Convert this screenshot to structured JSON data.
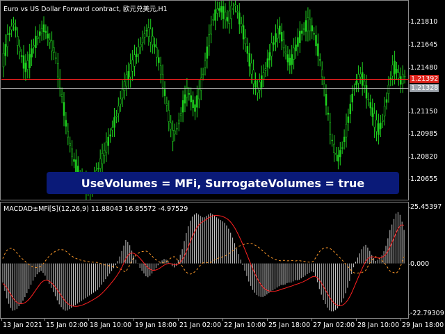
{
  "price_chart": {
    "title": "Euro vs US Dollar Forward contract, 欧元兑美元,H1",
    "scale_labels": [
      "1.21810",
      "1.21645",
      "1.21480",
      "1.21150",
      "1.20985",
      "1.20820",
      "1.20655"
    ],
    "bid_price": "1.21392",
    "ask_price": "1.21328",
    "candle_color": "#1fd21f",
    "closes": [
      1.215,
      1.2162,
      1.217,
      1.2175,
      1.216,
      1.2152,
      1.2145,
      1.2148,
      1.2158,
      1.2163,
      1.2168,
      1.2171,
      1.2166,
      1.216,
      1.2155,
      1.214,
      1.2125,
      1.2108,
      1.2095,
      1.2085,
      1.2078,
      1.2072,
      1.2068,
      1.2065,
      1.2066,
      1.2074,
      1.208,
      1.2086,
      1.2093,
      1.21,
      1.2108,
      1.2115,
      1.2125,
      1.2134,
      1.214,
      1.2146,
      1.2152,
      1.2158,
      1.2164,
      1.217,
      1.2166,
      1.216,
      1.2152,
      1.214,
      1.2126,
      1.2112,
      1.21,
      1.2104,
      1.2112,
      1.2122,
      1.213,
      1.2124,
      1.2118,
      1.2126,
      1.2138,
      1.215,
      1.2165,
      1.2177,
      1.2182,
      1.2184,
      1.218,
      1.2176,
      1.2182,
      1.2186,
      1.2178,
      1.217,
      1.216,
      1.2148,
      1.2138,
      1.213,
      1.2135,
      1.2142,
      1.215,
      1.2158,
      1.2165,
      1.217,
      1.2162,
      1.2152,
      1.2148,
      1.2155,
      1.2162,
      1.2168,
      1.2172,
      1.2174,
      1.217,
      1.2162,
      1.215,
      1.2134,
      1.2118,
      1.21,
      1.209,
      1.2085,
      1.2092,
      1.2102,
      1.2115,
      1.2128,
      1.2136,
      1.214,
      1.2135,
      1.2125,
      1.2118,
      1.2108,
      1.2104,
      1.211,
      1.2122,
      1.2136,
      1.2146,
      1.2142,
      1.2136,
      1.2139
    ]
  },
  "banner": {
    "text": "UseVolumes = MFi, SurrogateVolumes = true"
  },
  "indicator": {
    "title": "MACDAD±MFi[S](12,26,9) 11.88043 16.85572 -4.97529",
    "scale_labels": [
      "25.45397",
      "0.000",
      "-22.79309"
    ],
    "histogram_color": "#c8c8c8",
    "signal_color": "#ff2020",
    "dashed_color": "#ff9a2a",
    "histogram": [
      -8,
      -14,
      -18,
      -20,
      -19,
      -17,
      -15,
      -12,
      -9,
      -6,
      -4,
      -3,
      -5,
      -8,
      -11,
      -14,
      -17,
      -19,
      -20,
      -19,
      -18,
      -17,
      -16,
      -15,
      -14,
      -13,
      -12,
      -11,
      -9,
      -7,
      -5,
      -3,
      -1,
      2,
      6,
      10,
      8,
      4,
      1,
      -2,
      -4,
      -6,
      -5,
      -3,
      -1,
      1,
      2,
      1,
      -1,
      -2,
      2,
      6,
      12,
      17,
      20,
      21,
      20,
      19,
      20,
      21,
      20,
      19,
      18,
      17,
      15,
      12,
      8,
      4,
      0,
      -4,
      -8,
      -11,
      -13,
      -14,
      -14,
      -13,
      -12,
      -11,
      -10,
      -9,
      -9,
      -8,
      -8,
      -7,
      -7,
      -6,
      -5,
      -4,
      -3,
      -6,
      -11,
      -15,
      -18,
      -20,
      -20,
      -19,
      -17,
      -14,
      -10,
      -5,
      0,
      3,
      6,
      8,
      6,
      3,
      1,
      2,
      4,
      8,
      14,
      18,
      22,
      20,
      14
    ]
  },
  "time_axis": {
    "labels": [
      "13 Jan 2021",
      "15 Jan 02:00",
      "18 Jan 10:00",
      "19 Jan 18:00",
      "21 Jan 02:00",
      "22 Jan 10:00",
      "25 Jan 18:00",
      "27 Jan 02:00",
      "28 Jan 10:00",
      "29 Jan 18:00"
    ]
  }
}
